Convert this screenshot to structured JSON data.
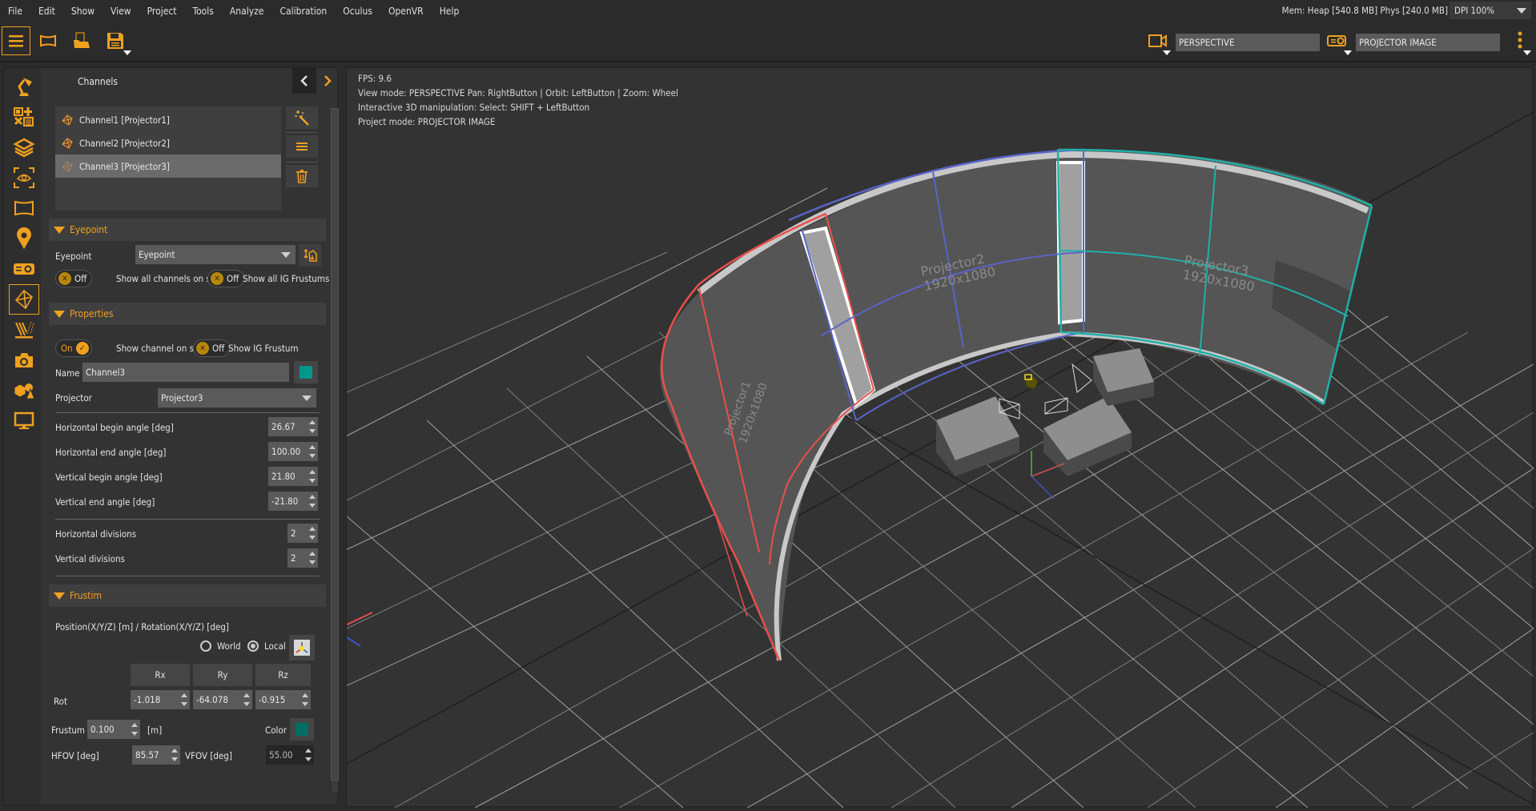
{
  "menu": [
    "File",
    "Edit",
    "Show",
    "View",
    "Project",
    "Tools",
    "Analyze",
    "Calibration",
    "Oculus",
    "OpenVR",
    "Help"
  ],
  "status": {
    "memory": "Mem: Heap [540.8 MB] Phys [240.0 MB]",
    "dpi": "DPI 100%"
  },
  "toolbar": {
    "left_icons": [
      "menu-icon",
      "screen-icon",
      "open-folder-icon",
      "save-icon"
    ],
    "camera_mode": "PERSPECTIVE",
    "project_mode": "PROJECTOR IMAGE"
  },
  "panel": {
    "title": "Channels",
    "sidebar_icons": [
      "desk-lamp-icon",
      "add-remove-list-icon",
      "layers-icon",
      "eye-focus-icon",
      "curved-screen-icon",
      "location-pin-icon",
      "projector-icon",
      "frustum-icon",
      "light-rays-icon",
      "camera-icon",
      "objects-icon",
      "monitor-icon"
    ],
    "channels": [
      {
        "label": "Channel1 [Projector1]",
        "selected": false
      },
      {
        "label": "Channel2 [Projector2]",
        "selected": false
      },
      {
        "label": "Channel3 [Projector3]",
        "selected": true
      }
    ],
    "eyepoint": {
      "section": "Eyepoint",
      "label": "Eyepoint",
      "value": "Eyepoint",
      "toggle1": {
        "state": "Off",
        "label": "Show all channels on screen"
      },
      "toggle2": {
        "state": "Off",
        "label": "Show all IG Frustums"
      }
    },
    "properties": {
      "section": "Properties",
      "toggle1": {
        "state": "On",
        "label": "Show channel on screen"
      },
      "toggle2": {
        "state": "Off",
        "label": "Show IG Frustum"
      },
      "name_label": "Name",
      "name_value": "Channel3",
      "channel_color": "#00968a",
      "projector_label": "Projector",
      "projector_value": "Projector3",
      "angles": [
        {
          "label": "Horizontal begin angle [deg]",
          "value": "26.67"
        },
        {
          "label": "Horizontal end angle [deg]",
          "value": "100.00"
        },
        {
          "label": "Vertical begin angle [deg]",
          "value": "21.80"
        },
        {
          "label": "Vertical end angle [deg]",
          "value": "-21.80"
        }
      ],
      "divisions": [
        {
          "label": "Horizontal divisions",
          "value": "2"
        },
        {
          "label": "Vertical divisions",
          "value": "2"
        }
      ]
    },
    "frustum": {
      "section": "Frustim",
      "pos_label": "Position(X/Y/Z) [m] / Rotation(X/Y/Z) [deg]",
      "world_label": "World",
      "local_label": "Local",
      "coord_mode": "Local",
      "headers": [
        "Rx",
        "Ry",
        "Rz"
      ],
      "rot_label": "Rot",
      "rot_values": [
        "-1.018",
        "-64.078",
        "-0.915"
      ],
      "frustum_label": "Frustum",
      "frustum_value": "0.100",
      "unit": "[m]",
      "color_label": "Color",
      "frustum_color": "#006e64",
      "hfov_label": "HFOV [deg]",
      "hfov_value": "85.57",
      "vfov_label": "VFOV [deg]",
      "vfov_value": "55.00"
    }
  },
  "viewport": {
    "overlay": [
      "FPS: 9.6",
      "View mode: PERSPECTIVE Pan: RightButton | Orbit: LeftButton | Zoom: Wheel",
      "Interactive 3D manipulation: Select: SHIFT + LeftButton",
      "Project mode: PROJECTOR IMAGE"
    ],
    "projectors": [
      {
        "name": "Projector1",
        "resolution": "1920x1080",
        "color": "#e8504a"
      },
      {
        "name": "Projector2",
        "resolution": "1920x1080",
        "color": "#5a64c8"
      },
      {
        "name": "Projector3",
        "resolution": "1920x1080",
        "color": "#20b0a8"
      }
    ]
  }
}
